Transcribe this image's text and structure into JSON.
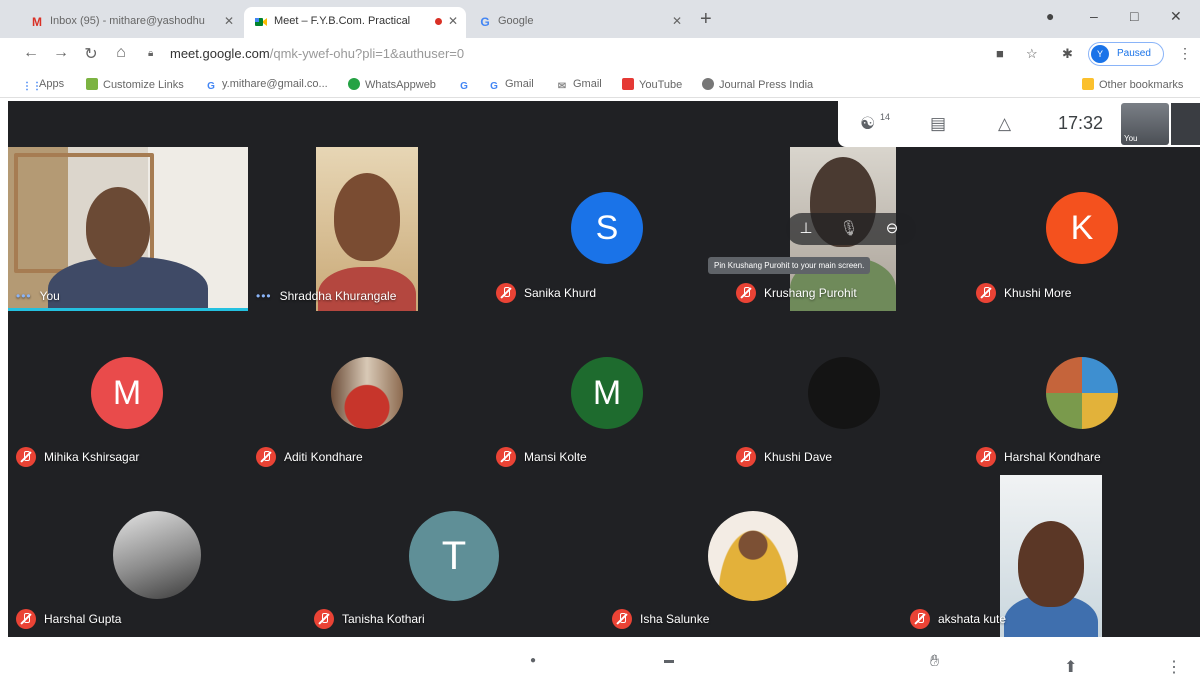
{
  "tabs": [
    {
      "title": "Inbox (95) - mithare@yashodhu",
      "favicon": "M",
      "active": false
    },
    {
      "title": "Meet – F.Y.B.Com. Practical",
      "favicon": "meet",
      "active": true,
      "recording": true
    },
    {
      "title": "Google",
      "favicon": "G",
      "active": false
    }
  ],
  "window_controls": {
    "minimize": "–",
    "maximize": "□",
    "close": "✕"
  },
  "address_bar": {
    "host": "meet.google.com",
    "path": "/qmk-ywef-ohu?pli=1&authuser=0"
  },
  "profile": {
    "initial": "Y",
    "label": "Paused"
  },
  "bookmarks": [
    {
      "label": "Apps",
      "icon": "apps-grid-icon"
    },
    {
      "label": "Customize Links",
      "icon": "customize-icon"
    },
    {
      "label": "y.mithare@gmail.co...",
      "icon": "google-icon"
    },
    {
      "label": "WhatsAppweb",
      "icon": "whatsapp-icon"
    },
    {
      "label": "",
      "icon": "google-icon"
    },
    {
      "label": "Gmail",
      "icon": "google-icon"
    },
    {
      "label": "Gmail",
      "icon": "gmail-icon"
    },
    {
      "label": "YouTube",
      "icon": "youtube-icon"
    },
    {
      "label": "Journal Press India",
      "icon": "journal-icon"
    },
    {
      "label": "Other bookmarks",
      "icon": "folder-icon"
    }
  ],
  "meet": {
    "participant_count": "14",
    "clock": "17:32",
    "self_label": "You",
    "tooltip": "Pin Krushang Purohit to your main screen.",
    "participants": [
      {
        "name": "You",
        "muted": false
      },
      {
        "name": "Shraddha Khurangale",
        "muted": false
      },
      {
        "name": "Sanika Khurd",
        "muted": true,
        "initial": "S",
        "color": "#1a73e8"
      },
      {
        "name": "Krushang Purohit",
        "muted": true
      },
      {
        "name": "Khushi More",
        "muted": true,
        "initial": "K",
        "color": "#f4511e"
      },
      {
        "name": "Mihika Kshirsagar",
        "muted": true,
        "initial": "M",
        "color": "#e94b4b"
      },
      {
        "name": "Aditi Kondhare",
        "muted": true
      },
      {
        "name": "Mansi Kolte",
        "muted": true,
        "initial": "M",
        "color": "#1e6b2e"
      },
      {
        "name": "Khushi Dave",
        "muted": true
      },
      {
        "name": "Harshal Kondhare",
        "muted": true
      },
      {
        "name": "Harshal Gupta",
        "muted": true
      },
      {
        "name": "Tanisha Kothari",
        "muted": true,
        "initial": "T",
        "color": "#5f8f97"
      },
      {
        "name": "Isha Salunke",
        "muted": true
      },
      {
        "name": "akshata kute",
        "muted": true
      }
    ]
  }
}
